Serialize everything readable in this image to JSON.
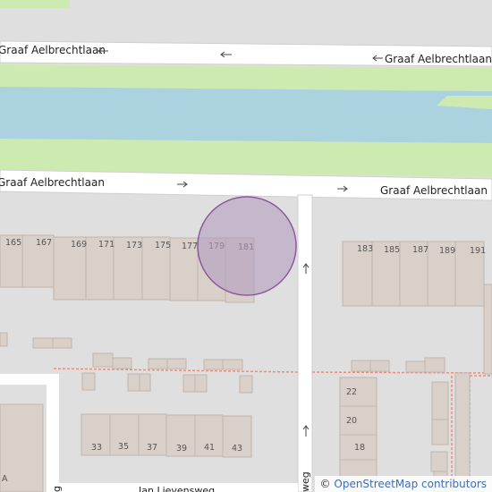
{
  "streets": {
    "top_left": "Graaf Aelbrechtlaan",
    "top_right": "Graaf Aelbrechtlaan",
    "middle_left": "Graaf Aelbrechtlaan",
    "middle_right": "Graaf Aelbrechtlaan",
    "bottom": "Jan Lievensweg",
    "side_a": "weg",
    "side_b": "g"
  },
  "house_numbers": {
    "n165": "165",
    "n167": "167",
    "n169": "169",
    "n171": "171",
    "n173": "173",
    "n175": "175",
    "n177": "177",
    "n179": "179",
    "n181": "181",
    "n183": "183",
    "n185": "185",
    "n187": "187",
    "n189": "189",
    "n191": "191",
    "n22": "22",
    "n20": "20",
    "n18": "18",
    "n33": "33",
    "n35": "35",
    "n37": "37",
    "n39": "39",
    "n41": "41",
    "n43": "43",
    "nA": "A"
  },
  "marker": {
    "type": "location-circle",
    "color": "#b39dbf",
    "stroke": "#8b5a9c"
  },
  "colors": {
    "water": "#aad3df",
    "grass": "#cdebb0",
    "building": "#d9d0c9",
    "road": "#ffffff",
    "land": "#e0dfdf"
  },
  "attribution": {
    "copyright": "©",
    "text": "OpenStreetMap contributors"
  }
}
